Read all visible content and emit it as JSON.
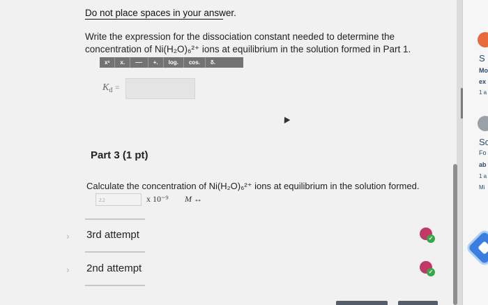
{
  "instruction": "Do not place spaces in your answer.",
  "question1": {
    "line1": "Write the expression for the dissociation constant needed to determine the",
    "line2": "concentration of Ni(H₂O)₆²⁺ ions at equilibrium in the solution formed in Part 1."
  },
  "toolbar": {
    "buttons": [
      "xˣ",
      "x.",
      "—·",
      "+.",
      "log.",
      "cos.",
      "δ."
    ]
  },
  "kd": {
    "label": "K",
    "sub": "d",
    "equals": "="
  },
  "part3": {
    "title": "Part 3 (1 pt)",
    "question": "Calculate the concentration of Ni(H₂O)₆²⁺ ions at equilibrium in the solution formed.",
    "answer_value": "2.2",
    "sci_notation": "x 10⁻⁹",
    "unit": "M ↔"
  },
  "attempts": [
    {
      "label": "3rd attempt"
    },
    {
      "label": "2nd attempt"
    }
  ],
  "side_panel": {
    "items1": [
      "S",
      "Mo",
      "ex",
      "1 a"
    ],
    "items2": [
      "Sc",
      "Fo",
      "ab",
      "1 a",
      "Mi"
    ]
  },
  "colors": {
    "accent": "#c0386a",
    "correct": "#3aa44a",
    "toolbar": "#737373"
  }
}
